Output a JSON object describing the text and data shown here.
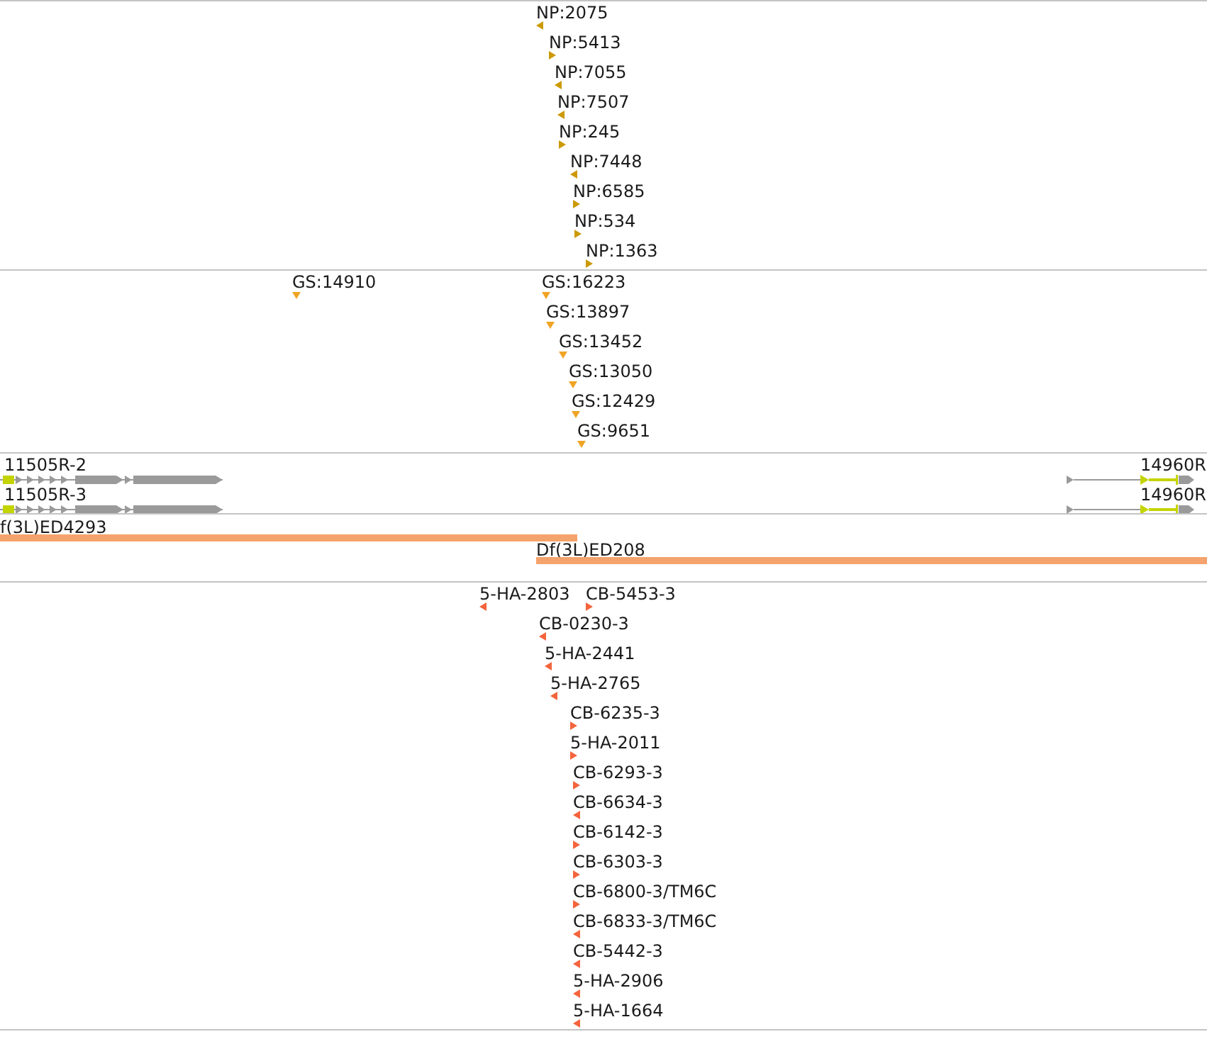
{
  "tracks": [
    {
      "kind": "stranded",
      "color": "#cc9a06",
      "features": [
        {
          "label": "NP:2075",
          "reverse": true
        },
        {
          "label": "NP:5413",
          "reverse": false
        },
        {
          "label": "NP:7055",
          "reverse": true
        },
        {
          "label": "NP:7507",
          "reverse": true
        },
        {
          "label": "NP:245",
          "reverse": false
        },
        {
          "label": "NP:7448",
          "reverse": true
        },
        {
          "label": "NP:6585",
          "reverse": false
        },
        {
          "label": "NP:534",
          "reverse": false
        },
        {
          "label": "NP:1363",
          "reverse": false
        }
      ]
    },
    {
      "kind": "point",
      "color": "#f0a424",
      "features": [
        {
          "label": "GS:14910"
        },
        {
          "label": "GS:16223"
        },
        {
          "label": "GS:13897"
        },
        {
          "label": "GS:13452"
        },
        {
          "label": "GS:13050"
        },
        {
          "label": "GS:12429"
        },
        {
          "label": "GS:9651"
        }
      ]
    },
    {
      "kind": "transcripts",
      "features": [
        {
          "label": "11505R-2"
        },
        {
          "label": "11505R-3"
        },
        {
          "label": "14960R"
        },
        {
          "label": "14960R"
        }
      ]
    },
    {
      "kind": "spans",
      "color": "#f5a36c",
      "features": [
        {
          "label": "f(3L)ED4293"
        },
        {
          "label": "Df(3L)ED208"
        }
      ]
    },
    {
      "kind": "stranded",
      "color": "#f4643c",
      "features": [
        {
          "label": "5-HA-2803",
          "reverse": true
        },
        {
          "label": "CB-5453-3",
          "reverse": false
        },
        {
          "label": "CB-0230-3",
          "reverse": true
        },
        {
          "label": "5-HA-2441",
          "reverse": true
        },
        {
          "label": "5-HA-2765",
          "reverse": true
        },
        {
          "label": "CB-6235-3",
          "reverse": false
        },
        {
          "label": "5-HA-2011",
          "reverse": false
        },
        {
          "label": "CB-6293-3",
          "reverse": false
        },
        {
          "label": "CB-6634-3",
          "reverse": true
        },
        {
          "label": "CB-6142-3",
          "reverse": false
        },
        {
          "label": "CB-6303-3",
          "reverse": false
        },
        {
          "label": "CB-6800-3/TM6C",
          "reverse": false
        },
        {
          "label": "CB-6833-3/TM6C",
          "reverse": true
        },
        {
          "label": "CB-5442-3",
          "reverse": true
        },
        {
          "label": "5-HA-2906",
          "reverse": true
        },
        {
          "label": "5-HA-1664",
          "reverse": true
        }
      ]
    }
  ]
}
